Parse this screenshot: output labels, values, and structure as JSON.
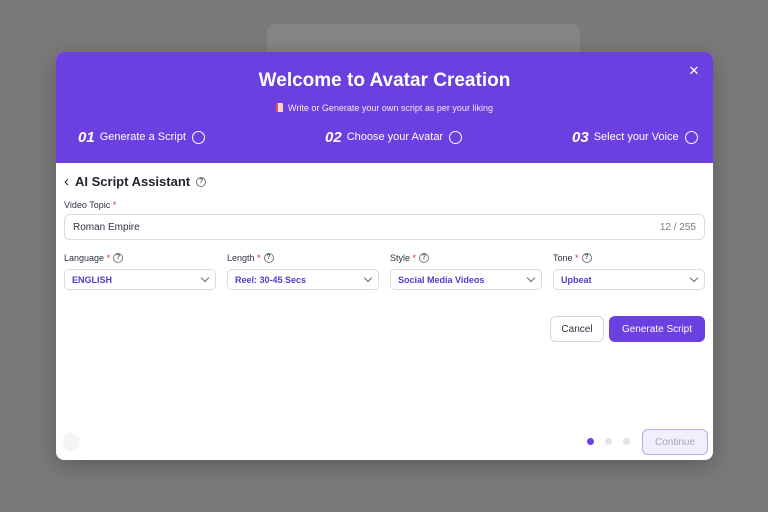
{
  "modal": {
    "title": "Welcome to Avatar Creation",
    "subtitle": "Write or Generate your own script as per your liking",
    "close_icon": "close-icon"
  },
  "steps": [
    {
      "num": "01",
      "label": "Generate a Script"
    },
    {
      "num": "02",
      "label": "Choose your Avatar"
    },
    {
      "num": "03",
      "label": "Select your Voice"
    }
  ],
  "assistant": {
    "title": "AI Script Assistant",
    "topic_label": "Video Topic",
    "topic_value": "Roman Empire",
    "topic_count": "12 / 255",
    "required_mark": "*"
  },
  "fields": [
    {
      "label": "Language",
      "value": "ENGLISH"
    },
    {
      "label": "Length",
      "value": "Reel: 30-45 Secs"
    },
    {
      "label": "Style",
      "value": "Social Media Videos"
    },
    {
      "label": "Tone",
      "value": "Upbeat"
    }
  ],
  "buttons": {
    "cancel": "Cancel",
    "generate": "Generate Script",
    "continue": "Continue"
  },
  "pagination": {
    "total": 3,
    "current": 1
  },
  "colors": {
    "accent": "#6b3fe0",
    "required": "#e02b2b"
  }
}
